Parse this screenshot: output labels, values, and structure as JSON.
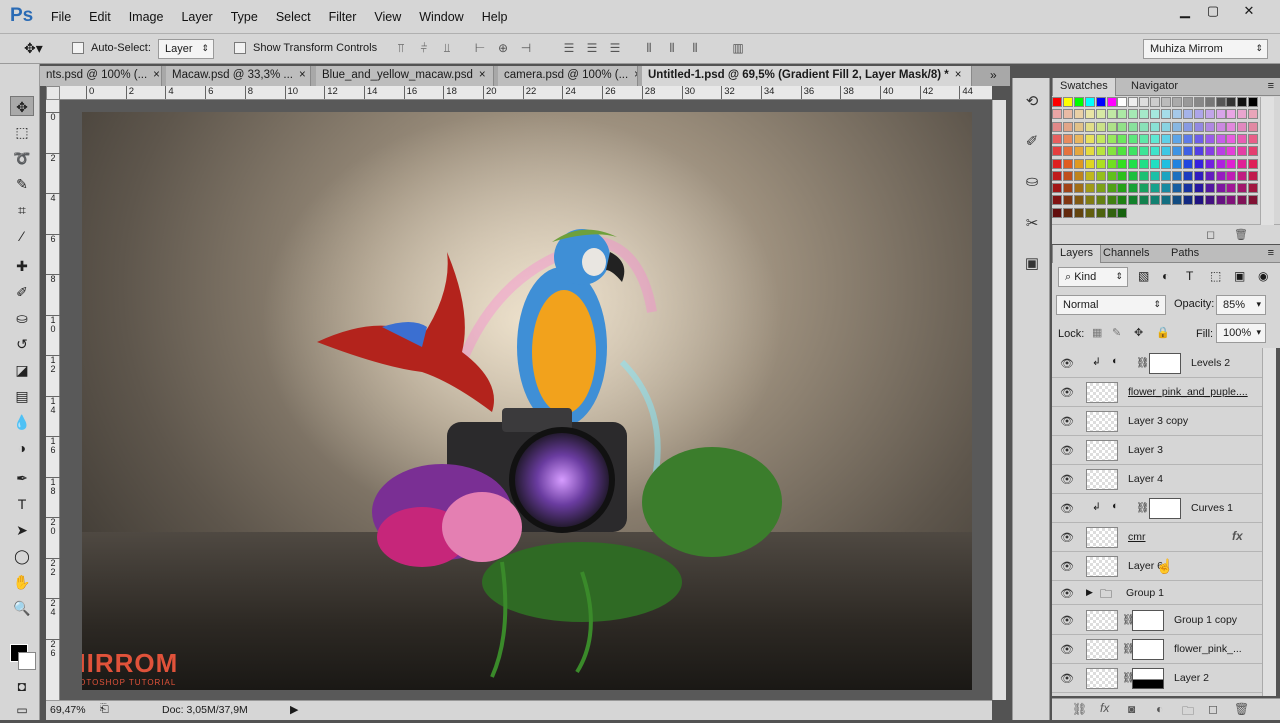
{
  "app": {
    "logo": "Ps",
    "menu": [
      "File",
      "Edit",
      "Image",
      "Layer",
      "Type",
      "Select",
      "Filter",
      "View",
      "Window",
      "Help"
    ]
  },
  "options": {
    "auto_select_label": "Auto-Select:",
    "auto_select_value": "Layer",
    "transform_label": "Show Transform Controls",
    "workspace": "Muhiza Mirrom"
  },
  "tabs": [
    {
      "label": "nts.psd @ 100% (..."
    },
    {
      "label": "Macaw.psd @ 33,3% ..."
    },
    {
      "label": "Blue_and_yellow_macaw.psd"
    },
    {
      "label": "camera.psd @ 100% (..."
    },
    {
      "label": "Untitled-1.psd @ 69,5% (Gradient Fill 2, Layer Mask/8) *"
    }
  ],
  "ruler": {
    "h": [
      "0",
      "2",
      "4",
      "6",
      "8",
      "10",
      "12",
      "14",
      "16",
      "18",
      "20",
      "22",
      "24",
      "26",
      "28",
      "30",
      "32",
      "34",
      "36",
      "38",
      "40",
      "42",
      "44"
    ],
    "v": [
      "0",
      "2",
      "4",
      "6",
      "8",
      "1\n0",
      "1\n2",
      "1\n4",
      "1\n6",
      "1\n8",
      "2\n0",
      "2\n2",
      "2\n4",
      "2\n6"
    ]
  },
  "status": {
    "zoom": "69,47%",
    "doc": "Doc: 3,05M/37,9M"
  },
  "watermark": {
    "title": "MIRROM",
    "subtitle": "PHOTOSHOP TUTORIAL"
  },
  "panels": {
    "swatch_tabs": [
      "Swatches",
      "Navigator"
    ],
    "layer_tabs": [
      "Layers",
      "Channels",
      "Paths"
    ],
    "kind": "Kind",
    "blend": "Normal",
    "opacity_label": "Opacity:",
    "opacity": "85%",
    "lock_label": "Lock:",
    "fill_label": "Fill:",
    "fill": "100%"
  },
  "layers": [
    {
      "name": "Levels 2",
      "type": "adjustment"
    },
    {
      "name": "flower_pink_and_puple....",
      "type": "layer",
      "underline": true
    },
    {
      "name": "Layer 3 copy",
      "type": "layer"
    },
    {
      "name": "Layer 3",
      "type": "layer"
    },
    {
      "name": "Layer 4",
      "type": "layer"
    },
    {
      "name": "Curves 1",
      "type": "adjustment"
    },
    {
      "name": "cmr",
      "type": "layer",
      "underline": true,
      "fx": "fx"
    },
    {
      "name": "Layer 6",
      "type": "layer"
    },
    {
      "name": "Group 1",
      "type": "group"
    },
    {
      "name": "Group 1 copy",
      "type": "masked"
    },
    {
      "name": "flower_pink_...",
      "type": "masked"
    },
    {
      "name": "Layer 2",
      "type": "masked"
    }
  ],
  "colors": {
    "chrome": "#d6d6d6",
    "canvas_bg": "#595959",
    "ps_blue": "#2a6bb5",
    "watermark": "#e0523a"
  }
}
